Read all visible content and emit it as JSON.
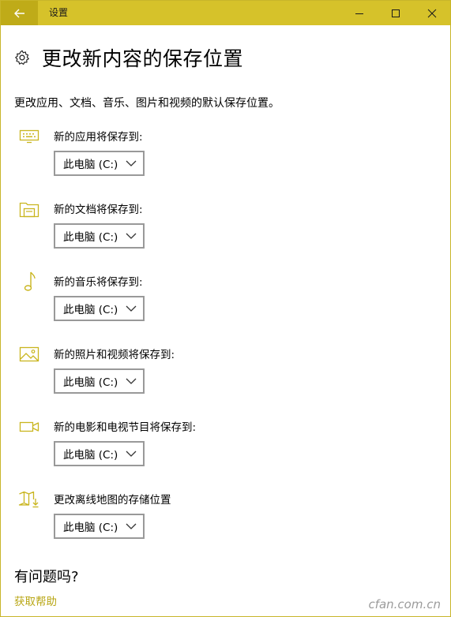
{
  "window": {
    "title": "设置",
    "accent": "#d6c22a",
    "accent_dark": "#bfab18",
    "link_color": "#b8a614"
  },
  "titlebar_icons": {
    "back": "back-arrow-icon",
    "minimize": "minimize-icon",
    "maximize": "maximize-icon",
    "close": "close-icon"
  },
  "header": {
    "icon": "gear-icon",
    "title": "更改新内容的保存位置"
  },
  "description": "更改应用、文档、音乐、图片和视频的默认保存位置。",
  "settings": [
    {
      "icon": "keyboard-icon",
      "label": "新的应用将保存到:",
      "value": "此电脑 (C:)"
    },
    {
      "icon": "folder-icon",
      "label": "新的文档将保存到:",
      "value": "此电脑 (C:)"
    },
    {
      "icon": "music-note-icon",
      "label": "新的音乐将保存到:",
      "value": "此电脑 (C:)"
    },
    {
      "icon": "photo-icon",
      "label": "新的照片和视频将保存到:",
      "value": "此电脑 (C:)"
    },
    {
      "icon": "video-camera-icon",
      "label": "新的电影和电视节目将保存到:",
      "value": "此电脑 (C:)"
    },
    {
      "icon": "offline-map-icon",
      "label": "更改离线地图的存储位置",
      "value": "此电脑 (C:)"
    }
  ],
  "help": {
    "title": "有问题吗?",
    "link": "获取帮助"
  },
  "watermark": "cfan.com.cn"
}
